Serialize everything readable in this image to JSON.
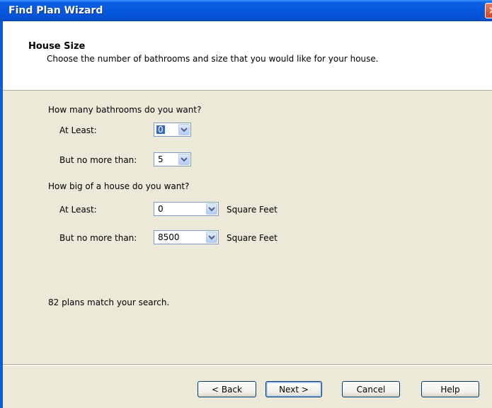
{
  "window": {
    "title": "Find Plan Wizard"
  },
  "header": {
    "title": "House Size",
    "description": "Choose the number of bathrooms and size that you would like for your house."
  },
  "bathrooms": {
    "question": "How many bathrooms do you want?",
    "min_label": "At Least:",
    "min_value": "0",
    "max_label": "But no more than:",
    "max_value": "5"
  },
  "size": {
    "question": "How big of a house do you want?",
    "min_label": "At Least:",
    "min_value": "0",
    "max_label": "But no more than:",
    "max_value": "8500",
    "unit": "Square Feet"
  },
  "status": "82 plans match your search.",
  "buttons": {
    "back": "< Back",
    "next": "Next >",
    "cancel": "Cancel",
    "help": "Help"
  },
  "colors": {
    "title_bar": "#0758de",
    "selection": "#316ac5",
    "dialog_bg": "#ece9d8"
  }
}
